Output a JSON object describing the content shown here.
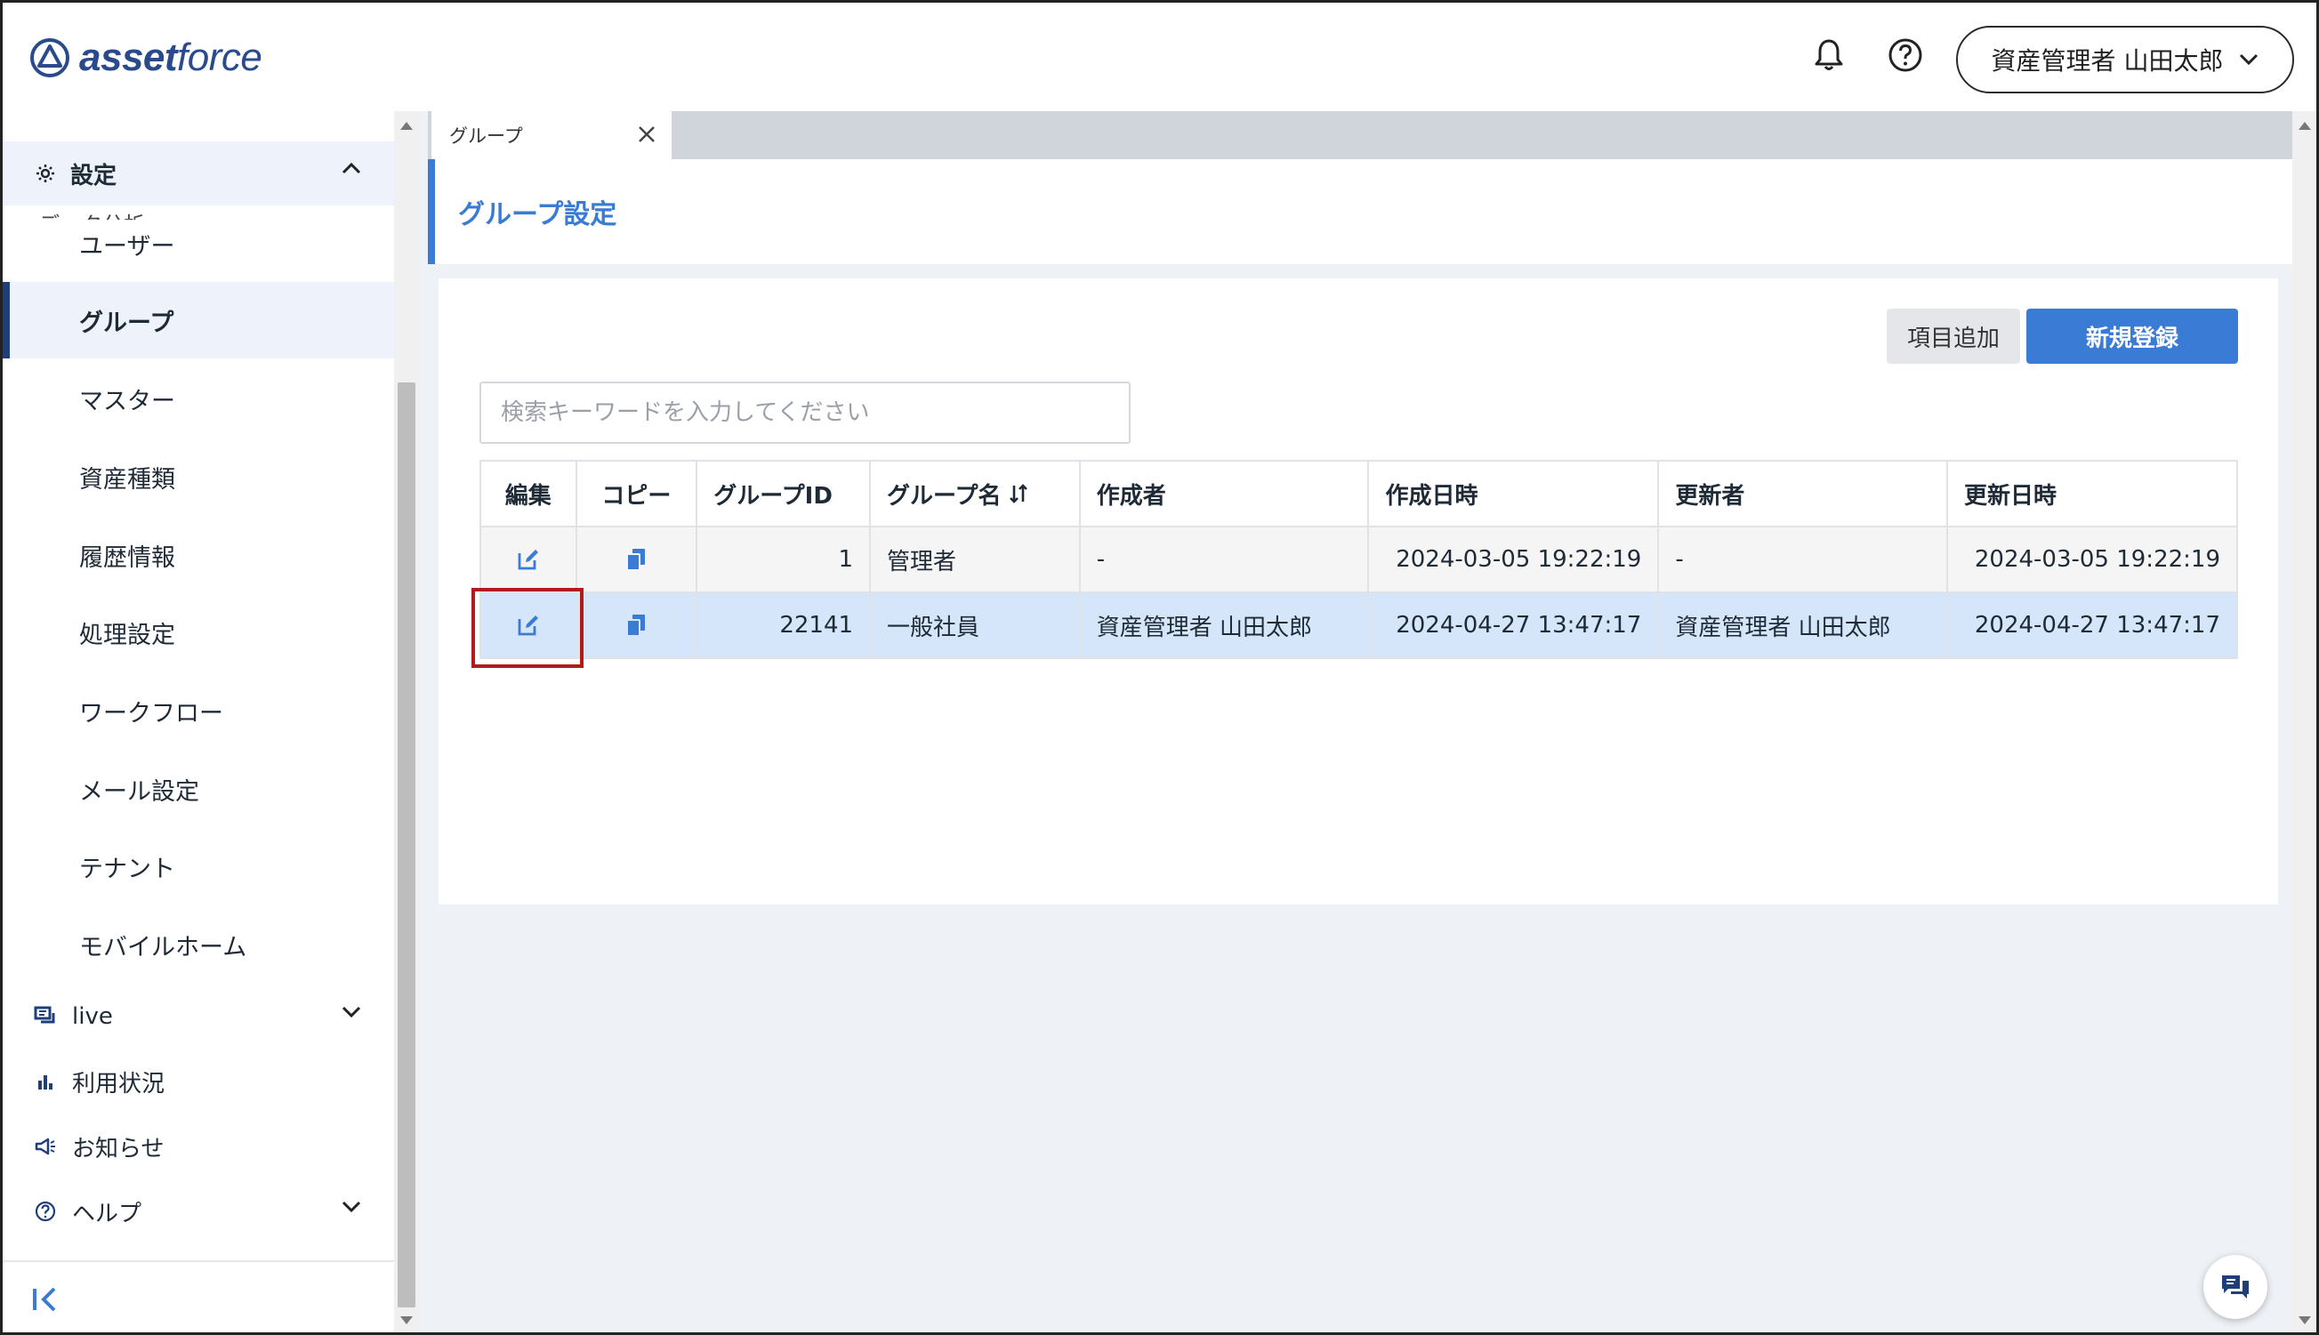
{
  "brand": {
    "logo_bold": "asset",
    "logo_light": "force",
    "accent": "#3a7bd5",
    "brand_color": "#2a4a8c"
  },
  "header": {
    "user_label": "資産管理者 山田太郎",
    "icons": [
      "bell-icon",
      "help-circle-icon",
      "chevron-down-icon"
    ]
  },
  "sidebar": {
    "cut_item": "データ分析",
    "section": {
      "label": "設定"
    },
    "items": [
      {
        "label": "ユーザー"
      },
      {
        "label": "グループ"
      },
      {
        "label": "マスター"
      },
      {
        "label": "資産種類"
      },
      {
        "label": "履歴情報"
      },
      {
        "label": "処理設定"
      },
      {
        "label": "ワークフロー"
      },
      {
        "label": "メール設定"
      },
      {
        "label": "テナント"
      },
      {
        "label": "モバイルホーム"
      }
    ],
    "groups": [
      {
        "label": "live"
      },
      {
        "label": "利用状況"
      },
      {
        "label": "お知らせ"
      },
      {
        "label": "ヘルプ"
      }
    ]
  },
  "tabs": [
    {
      "label": "グループ"
    }
  ],
  "page": {
    "title": "グループ設定"
  },
  "toolbar": {
    "add_field_label": "項目追加",
    "new_label": "新規登録"
  },
  "search": {
    "placeholder": "検索キーワードを入力してください",
    "value": ""
  },
  "table": {
    "columns": [
      "編集",
      "コピー",
      "グループID",
      "グループ名",
      "作成者",
      "作成日時",
      "更新者",
      "更新日時"
    ],
    "rows": [
      {
        "group_id": "1",
        "group_name": "管理者",
        "created_by": "-",
        "created_at": "2024-03-05 19:22:19",
        "updated_by": "-",
        "updated_at": "2024-03-05 19:22:19"
      },
      {
        "group_id": "22141",
        "group_name": "一般社員",
        "created_by": "資産管理者 山田太郎",
        "created_at": "2024-04-27 13:47:17",
        "updated_by": "資産管理者 山田太郎",
        "updated_at": "2024-04-27 13:47:17"
      }
    ]
  }
}
